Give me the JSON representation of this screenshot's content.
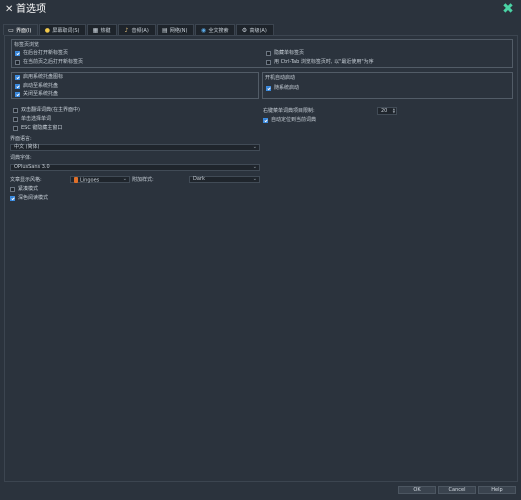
{
  "window": {
    "title": "首选项",
    "title_icon": "tools-icon",
    "close_icon": "close-icon",
    "accent": "#4ad3a5"
  },
  "tabs": [
    {
      "label": "界面(I)",
      "icon": "monitor-icon",
      "active": true
    },
    {
      "label": "屏幕取词(S)",
      "icon": "bulb-icon",
      "active": false
    },
    {
      "label": "热键",
      "icon": "keyboard-icon",
      "active": false
    },
    {
      "label": "音频(A)",
      "icon": "music-icon",
      "active": false
    },
    {
      "label": "网络(N)",
      "icon": "network-icon",
      "active": false
    },
    {
      "label": "全文搜索",
      "icon": "globe-icon",
      "active": false
    },
    {
      "label": "高级(A)",
      "icon": "gear-icon",
      "active": false
    }
  ],
  "tabs_group": {
    "title": "标签页浏览",
    "left": [
      {
        "label": "在后台打开新标签页",
        "checked": true
      },
      {
        "label": "在当前页之后打开新标签页",
        "checked": false
      }
    ],
    "right": [
      {
        "label": "隐藏单标签页",
        "checked": false
      },
      {
        "label": "用 Ctrl-Tab 浏览标签页时, 以\"最近使用\"为序",
        "checked": false
      }
    ]
  },
  "tray_group": {
    "title": "启用系统托盘图标",
    "title_checked": true,
    "items": [
      {
        "label": "启动至系统托盘",
        "checked": true
      },
      {
        "label": "关闭至系统托盘",
        "checked": true
      }
    ]
  },
  "startup_group": {
    "title": "开机自动启动",
    "items": [
      {
        "label": "随系统启动",
        "checked": true
      }
    ]
  },
  "misc_left": [
    {
      "label": "双击翻译词典(在主界面中)",
      "checked": false
    },
    {
      "label": "单击选择单词",
      "checked": false
    },
    {
      "label": "ESC 键隐藏主窗口",
      "checked": false
    }
  ],
  "history": {
    "label": "右键菜单词典项目限制:",
    "value": "20"
  },
  "auto_focus": {
    "label": "自动定位到当前词典",
    "checked": true
  },
  "interface_lang": {
    "label": "界面语言:",
    "value": "中文 (简体)"
  },
  "dict_font": {
    "label": "词典字体:",
    "value": "OPlusSans 3.0"
  },
  "article_style": {
    "label": "文章显示风格:",
    "value": "Lingoes",
    "swatch": "#e0702a"
  },
  "addon_style": {
    "label": "附加样式:",
    "value": "Dark"
  },
  "bottom_checks": [
    {
      "label": "紧凑模式",
      "checked": false
    },
    {
      "label": "深色阅读模式",
      "checked": true
    }
  ],
  "buttons": {
    "ok": "OK",
    "cancel": "Cancel",
    "help": "Help"
  }
}
